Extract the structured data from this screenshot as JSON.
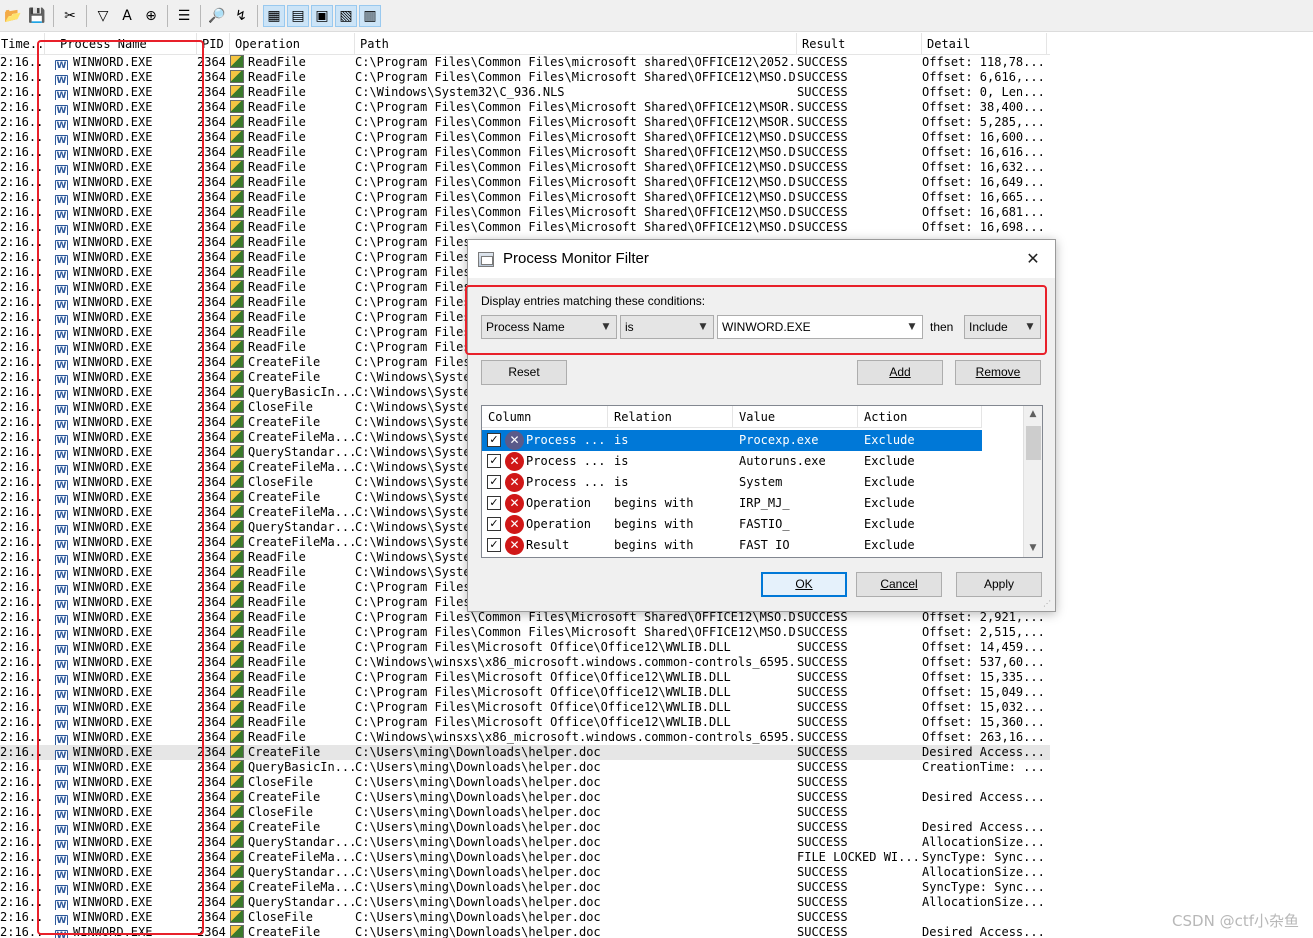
{
  "toolbar": {
    "buttons": [
      {
        "name": "open-icon",
        "glyph": "📂"
      },
      {
        "name": "save-icon",
        "glyph": "💾"
      },
      {
        "name": "clear-icon",
        "glyph": "✂"
      },
      {
        "name": "filter-icon",
        "glyph": "▽"
      },
      {
        "name": "highlight-icon",
        "glyph": "A"
      },
      {
        "name": "crosshair-icon",
        "glyph": "⊕"
      },
      {
        "name": "properties-icon",
        "glyph": "☰"
      },
      {
        "name": "find-icon",
        "glyph": "🔎"
      },
      {
        "name": "jump-icon",
        "glyph": "↯"
      },
      {
        "name": "registry-icon",
        "glyph": "▦"
      },
      {
        "name": "filesystem-icon",
        "glyph": "▤"
      },
      {
        "name": "network-icon",
        "glyph": "▣"
      },
      {
        "name": "process-icon",
        "glyph": "▧"
      },
      {
        "name": "profiling-icon",
        "glyph": "▥"
      }
    ]
  },
  "table": {
    "columns": [
      "Time...",
      "Process Name",
      "PID",
      "Operation",
      "Path",
      "Result",
      "Detail"
    ],
    "rows": [
      {
        "time": "2:16...",
        "process": "WINWORD.EXE",
        "pid": "2364",
        "op": "ReadFile",
        "path": "C:\\Program Files\\Common Files\\microsoft shared\\OFFICE12\\2052...",
        "result": "SUCCESS",
        "detail": "Offset: 118,78..."
      },
      {
        "time": "2:16...",
        "process": "WINWORD.EXE",
        "pid": "2364",
        "op": "ReadFile",
        "path": "C:\\Program Files\\Common Files\\Microsoft Shared\\OFFICE12\\MSO.DLL",
        "result": "SUCCESS",
        "detail": "Offset: 6,616,..."
      },
      {
        "time": "2:16...",
        "process": "WINWORD.EXE",
        "pid": "2364",
        "op": "ReadFile",
        "path": "C:\\Windows\\System32\\C_936.NLS",
        "result": "SUCCESS",
        "detail": "Offset: 0, Len..."
      },
      {
        "time": "2:16...",
        "process": "WINWORD.EXE",
        "pid": "2364",
        "op": "ReadFile",
        "path": "C:\\Program Files\\Common Files\\Microsoft Shared\\OFFICE12\\MSOR...",
        "result": "SUCCESS",
        "detail": "Offset: 38,400..."
      },
      {
        "time": "2:16...",
        "process": "WINWORD.EXE",
        "pid": "2364",
        "op": "ReadFile",
        "path": "C:\\Program Files\\Common Files\\Microsoft Shared\\OFFICE12\\MSOR...",
        "result": "SUCCESS",
        "detail": "Offset: 5,285,..."
      },
      {
        "time": "2:16...",
        "process": "WINWORD.EXE",
        "pid": "2364",
        "op": "ReadFile",
        "path": "C:\\Program Files\\Common Files\\Microsoft Shared\\OFFICE12\\MSO.DLL",
        "result": "SUCCESS",
        "detail": "Offset: 16,600..."
      },
      {
        "time": "2:16...",
        "process": "WINWORD.EXE",
        "pid": "2364",
        "op": "ReadFile",
        "path": "C:\\Program Files\\Common Files\\Microsoft Shared\\OFFICE12\\MSO.DLL",
        "result": "SUCCESS",
        "detail": "Offset: 16,616..."
      },
      {
        "time": "2:16...",
        "process": "WINWORD.EXE",
        "pid": "2364",
        "op": "ReadFile",
        "path": "C:\\Program Files\\Common Files\\Microsoft Shared\\OFFICE12\\MSO.DLL",
        "result": "SUCCESS",
        "detail": "Offset: 16,632..."
      },
      {
        "time": "2:16...",
        "process": "WINWORD.EXE",
        "pid": "2364",
        "op": "ReadFile",
        "path": "C:\\Program Files\\Common Files\\Microsoft Shared\\OFFICE12\\MSO.DLL",
        "result": "SUCCESS",
        "detail": "Offset: 16,649..."
      },
      {
        "time": "2:16...",
        "process": "WINWORD.EXE",
        "pid": "2364",
        "op": "ReadFile",
        "path": "C:\\Program Files\\Common Files\\Microsoft Shared\\OFFICE12\\MSO.DLL",
        "result": "SUCCESS",
        "detail": "Offset: 16,665..."
      },
      {
        "time": "2:16...",
        "process": "WINWORD.EXE",
        "pid": "2364",
        "op": "ReadFile",
        "path": "C:\\Program Files\\Common Files\\Microsoft Shared\\OFFICE12\\MSO.DLL",
        "result": "SUCCESS",
        "detail": "Offset: 16,681..."
      },
      {
        "time": "2:16...",
        "process": "WINWORD.EXE",
        "pid": "2364",
        "op": "ReadFile",
        "path": "C:\\Program Files\\Common Files\\Microsoft Shared\\OFFICE12\\MSO.DLL",
        "result": "SUCCESS",
        "detail": "Offset: 16,698..."
      },
      {
        "time": "2:16...",
        "process": "WINWORD.EXE",
        "pid": "2364",
        "op": "ReadFile",
        "path": "C:\\Program Files",
        "result": "",
        "detail": ""
      },
      {
        "time": "2:16...",
        "process": "WINWORD.EXE",
        "pid": "2364",
        "op": "ReadFile",
        "path": "C:\\Program Files",
        "result": "",
        "detail": ""
      },
      {
        "time": "2:16...",
        "process": "WINWORD.EXE",
        "pid": "2364",
        "op": "ReadFile",
        "path": "C:\\Program Files",
        "result": "",
        "detail": ""
      },
      {
        "time": "2:16...",
        "process": "WINWORD.EXE",
        "pid": "2364",
        "op": "ReadFile",
        "path": "C:\\Program Files",
        "result": "",
        "detail": ""
      },
      {
        "time": "2:16...",
        "process": "WINWORD.EXE",
        "pid": "2364",
        "op": "ReadFile",
        "path": "C:\\Program Files",
        "result": "",
        "detail": ""
      },
      {
        "time": "2:16...",
        "process": "WINWORD.EXE",
        "pid": "2364",
        "op": "ReadFile",
        "path": "C:\\Program Files",
        "result": "",
        "detail": ""
      },
      {
        "time": "2:16...",
        "process": "WINWORD.EXE",
        "pid": "2364",
        "op": "ReadFile",
        "path": "C:\\Program Files",
        "result": "",
        "detail": ""
      },
      {
        "time": "2:16...",
        "process": "WINWORD.EXE",
        "pid": "2364",
        "op": "ReadFile",
        "path": "C:\\Program Files",
        "result": "",
        "detail": ""
      },
      {
        "time": "2:16...",
        "process": "WINWORD.EXE",
        "pid": "2364",
        "op": "CreateFile",
        "path": "C:\\Program Files",
        "result": "",
        "detail": ""
      },
      {
        "time": "2:16...",
        "process": "WINWORD.EXE",
        "pid": "2364",
        "op": "CreateFile",
        "path": "C:\\Windows\\Syste",
        "result": "",
        "detail": ""
      },
      {
        "time": "2:16...",
        "process": "WINWORD.EXE",
        "pid": "2364",
        "op": "QueryBasicIn...",
        "path": "C:\\Windows\\Syste",
        "result": "",
        "detail": ""
      },
      {
        "time": "2:16...",
        "process": "WINWORD.EXE",
        "pid": "2364",
        "op": "CloseFile",
        "path": "C:\\Windows\\Syste",
        "result": "",
        "detail": ""
      },
      {
        "time": "2:16...",
        "process": "WINWORD.EXE",
        "pid": "2364",
        "op": "CreateFile",
        "path": "C:\\Windows\\Syste",
        "result": "",
        "detail": ""
      },
      {
        "time": "2:16...",
        "process": "WINWORD.EXE",
        "pid": "2364",
        "op": "CreateFileMa...",
        "path": "C:\\Windows\\Syste",
        "result": "",
        "detail": ""
      },
      {
        "time": "2:16...",
        "process": "WINWORD.EXE",
        "pid": "2364",
        "op": "QueryStandar...",
        "path": "C:\\Windows\\Syste",
        "result": "",
        "detail": ""
      },
      {
        "time": "2:16...",
        "process": "WINWORD.EXE",
        "pid": "2364",
        "op": "CreateFileMa...",
        "path": "C:\\Windows\\Syste",
        "result": "",
        "detail": ""
      },
      {
        "time": "2:16...",
        "process": "WINWORD.EXE",
        "pid": "2364",
        "op": "CloseFile",
        "path": "C:\\Windows\\Syste",
        "result": "",
        "detail": ""
      },
      {
        "time": "2:16...",
        "process": "WINWORD.EXE",
        "pid": "2364",
        "op": "CreateFile",
        "path": "C:\\Windows\\Syste",
        "result": "",
        "detail": ""
      },
      {
        "time": "2:16...",
        "process": "WINWORD.EXE",
        "pid": "2364",
        "op": "CreateFileMa...",
        "path": "C:\\Windows\\Syste",
        "result": "",
        "detail": ""
      },
      {
        "time": "2:16...",
        "process": "WINWORD.EXE",
        "pid": "2364",
        "op": "QueryStandar...",
        "path": "C:\\Windows\\Syste",
        "result": "",
        "detail": ""
      },
      {
        "time": "2:16...",
        "process": "WINWORD.EXE",
        "pid": "2364",
        "op": "CreateFileMa...",
        "path": "C:\\Windows\\Syste",
        "result": "",
        "detail": ""
      },
      {
        "time": "2:16...",
        "process": "WINWORD.EXE",
        "pid": "2364",
        "op": "ReadFile",
        "path": "C:\\Windows\\Syste",
        "result": "",
        "detail": ""
      },
      {
        "time": "2:16...",
        "process": "WINWORD.EXE",
        "pid": "2364",
        "op": "ReadFile",
        "path": "C:\\Windows\\Syste",
        "result": "",
        "detail": ""
      },
      {
        "time": "2:16...",
        "process": "WINWORD.EXE",
        "pid": "2364",
        "op": "ReadFile",
        "path": "C:\\Program Files",
        "result": "",
        "detail": ""
      },
      {
        "time": "2:16...",
        "process": "WINWORD.EXE",
        "pid": "2364",
        "op": "ReadFile",
        "path": "C:\\Program Files",
        "result": "",
        "detail": ""
      },
      {
        "time": "2:16...",
        "process": "WINWORD.EXE",
        "pid": "2364",
        "op": "ReadFile",
        "path": "C:\\Program Files\\Common Files\\Microsoft Shared\\OFFICE12\\MSO.DLL",
        "result": "SUCCESS",
        "detail": "Offset: 2,921,..."
      },
      {
        "time": "2:16...",
        "process": "WINWORD.EXE",
        "pid": "2364",
        "op": "ReadFile",
        "path": "C:\\Program Files\\Common Files\\Microsoft Shared\\OFFICE12\\MSO.DLL",
        "result": "SUCCESS",
        "detail": "Offset: 2,515,..."
      },
      {
        "time": "2:16...",
        "process": "WINWORD.EXE",
        "pid": "2364",
        "op": "ReadFile",
        "path": "C:\\Program Files\\Microsoft Office\\Office12\\WWLIB.DLL",
        "result": "SUCCESS",
        "detail": "Offset: 14,459..."
      },
      {
        "time": "2:16...",
        "process": "WINWORD.EXE",
        "pid": "2364",
        "op": "ReadFile",
        "path": "C:\\Windows\\winsxs\\x86_microsoft.windows.common-controls_6595...",
        "result": "SUCCESS",
        "detail": "Offset: 537,60..."
      },
      {
        "time": "2:16...",
        "process": "WINWORD.EXE",
        "pid": "2364",
        "op": "ReadFile",
        "path": "C:\\Program Files\\Microsoft Office\\Office12\\WWLIB.DLL",
        "result": "SUCCESS",
        "detail": "Offset: 15,335..."
      },
      {
        "time": "2:16...",
        "process": "WINWORD.EXE",
        "pid": "2364",
        "op": "ReadFile",
        "path": "C:\\Program Files\\Microsoft Office\\Office12\\WWLIB.DLL",
        "result": "SUCCESS",
        "detail": "Offset: 15,049..."
      },
      {
        "time": "2:16...",
        "process": "WINWORD.EXE",
        "pid": "2364",
        "op": "ReadFile",
        "path": "C:\\Program Files\\Microsoft Office\\Office12\\WWLIB.DLL",
        "result": "SUCCESS",
        "detail": "Offset: 15,032..."
      },
      {
        "time": "2:16...",
        "process": "WINWORD.EXE",
        "pid": "2364",
        "op": "ReadFile",
        "path": "C:\\Program Files\\Microsoft Office\\Office12\\WWLIB.DLL",
        "result": "SUCCESS",
        "detail": "Offset: 15,360..."
      },
      {
        "time": "2:16...",
        "process": "WINWORD.EXE",
        "pid": "2364",
        "op": "ReadFile",
        "path": "C:\\Windows\\winsxs\\x86_microsoft.windows.common-controls_6595...",
        "result": "SUCCESS",
        "detail": "Offset: 263,16..."
      },
      {
        "time": "2:16...",
        "process": "WINWORD.EXE",
        "pid": "2364",
        "op": "CreateFile",
        "path": "C:\\Users\\ming\\Downloads\\helper.doc",
        "result": "SUCCESS",
        "detail": "Desired Access...",
        "selected": true
      },
      {
        "time": "2:16...",
        "process": "WINWORD.EXE",
        "pid": "2364",
        "op": "QueryBasicIn...",
        "path": "C:\\Users\\ming\\Downloads\\helper.doc",
        "result": "SUCCESS",
        "detail": "CreationTime: ..."
      },
      {
        "time": "2:16...",
        "process": "WINWORD.EXE",
        "pid": "2364",
        "op": "CloseFile",
        "path": "C:\\Users\\ming\\Downloads\\helper.doc",
        "result": "SUCCESS",
        "detail": ""
      },
      {
        "time": "2:16...",
        "process": "WINWORD.EXE",
        "pid": "2364",
        "op": "CreateFile",
        "path": "C:\\Users\\ming\\Downloads\\helper.doc",
        "result": "SUCCESS",
        "detail": "Desired Access..."
      },
      {
        "time": "2:16...",
        "process": "WINWORD.EXE",
        "pid": "2364",
        "op": "CloseFile",
        "path": "C:\\Users\\ming\\Downloads\\helper.doc",
        "result": "SUCCESS",
        "detail": ""
      },
      {
        "time": "2:16...",
        "process": "WINWORD.EXE",
        "pid": "2364",
        "op": "CreateFile",
        "path": "C:\\Users\\ming\\Downloads\\helper.doc",
        "result": "SUCCESS",
        "detail": "Desired Access..."
      },
      {
        "time": "2:16...",
        "process": "WINWORD.EXE",
        "pid": "2364",
        "op": "QueryStandar...",
        "path": "C:\\Users\\ming\\Downloads\\helper.doc",
        "result": "SUCCESS",
        "detail": "AllocationSize..."
      },
      {
        "time": "2:16...",
        "process": "WINWORD.EXE",
        "pid": "2364",
        "op": "CreateFileMa...",
        "path": "C:\\Users\\ming\\Downloads\\helper.doc",
        "result": "FILE LOCKED WI...",
        "detail": "SyncType: Sync..."
      },
      {
        "time": "2:16...",
        "process": "WINWORD.EXE",
        "pid": "2364",
        "op": "QueryStandar...",
        "path": "C:\\Users\\ming\\Downloads\\helper.doc",
        "result": "SUCCESS",
        "detail": "AllocationSize..."
      },
      {
        "time": "2:16...",
        "process": "WINWORD.EXE",
        "pid": "2364",
        "op": "CreateFileMa...",
        "path": "C:\\Users\\ming\\Downloads\\helper.doc",
        "result": "SUCCESS",
        "detail": "SyncType: Sync..."
      },
      {
        "time": "2:16...",
        "process": "WINWORD.EXE",
        "pid": "2364",
        "op": "QueryStandar...",
        "path": "C:\\Users\\ming\\Downloads\\helper.doc",
        "result": "SUCCESS",
        "detail": "AllocationSize..."
      },
      {
        "time": "2:16...",
        "process": "WINWORD.EXE",
        "pid": "2364",
        "op": "CloseFile",
        "path": "C:\\Users\\ming\\Downloads\\helper.doc",
        "result": "SUCCESS",
        "detail": ""
      },
      {
        "time": "2:16...",
        "process": "WINWORD.EXE",
        "pid": "2364",
        "op": "CreateFile",
        "path": "C:\\Users\\ming\\Downloads\\helper.doc",
        "result": "SUCCESS",
        "detail": "Desired Access..."
      }
    ]
  },
  "dialog": {
    "title": "Process Monitor Filter",
    "close_glyph": "✕",
    "condition_label": "Display entries matching these conditions:",
    "column_value": "Process Name",
    "relation_value": "is",
    "value_value": "WINWORD.EXE",
    "then_label": "then",
    "action_value": "Include",
    "reset_label": "Reset",
    "add_label": "Add",
    "remove_label": "Remove",
    "ok_label": "OK",
    "cancel_label": "Cancel",
    "apply_label": "Apply",
    "list_headers": [
      "Column",
      "Relation",
      "Value",
      "Action"
    ],
    "rules": [
      {
        "column": "Process ...",
        "relation": "is",
        "value": "Procexp.exe",
        "action": "Exclude",
        "checked": true,
        "selected": true
      },
      {
        "column": "Process ...",
        "relation": "is",
        "value": "Autoruns.exe",
        "action": "Exclude",
        "checked": true
      },
      {
        "column": "Process ...",
        "relation": "is",
        "value": "System",
        "action": "Exclude",
        "checked": true
      },
      {
        "column": "Operation",
        "relation": "begins with",
        "value": "IRP_MJ_",
        "action": "Exclude",
        "checked": true
      },
      {
        "column": "Operation",
        "relation": "begins with",
        "value": "FASTIO_",
        "action": "Exclude",
        "checked": true
      },
      {
        "column": "Result",
        "relation": "begins with",
        "value": "FAST IO",
        "action": "Exclude",
        "checked": true
      }
    ]
  },
  "watermark": "CSDN @ctf小杂鱼",
  "colors": {
    "annotation": "#e8202a",
    "selection": "#0078d7"
  }
}
